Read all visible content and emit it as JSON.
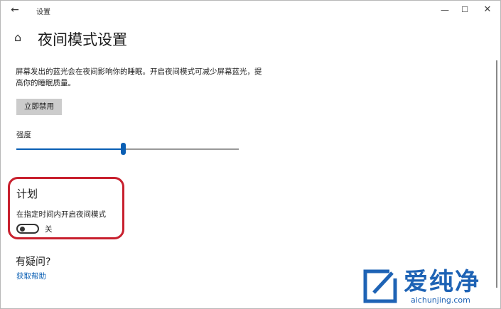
{
  "window": {
    "back_glyph": "←",
    "title": "设置",
    "controls": {
      "minimize": "—",
      "maximize": "☐",
      "close": "✕"
    }
  },
  "page": {
    "home_glyph": "⌂",
    "title": "夜间模式设置",
    "description": "屏幕发出的蓝光会在夜间影响你的睡眠。开启夜间模式可减少屏幕蓝光，提高你的睡眠质量。",
    "disable_button": "立即禁用"
  },
  "strength": {
    "label": "强度",
    "value_fraction": 0.48
  },
  "schedule": {
    "heading": "计划",
    "toggle_description": "在指定时间内开启夜间模式",
    "toggle_state": "关",
    "toggle_on": false
  },
  "help": {
    "heading": "有疑问?",
    "link": "获取帮助"
  },
  "watermark": {
    "text": "爱纯净",
    "url": "aichunjing.com"
  },
  "colors": {
    "accent": "#0a5fb4",
    "highlight": "#c8202e",
    "button_bg": "#cccccc"
  }
}
